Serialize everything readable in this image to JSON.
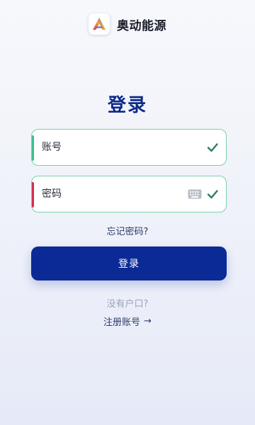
{
  "app": {
    "brand_name": "奥动能源",
    "logo_icon": "triangle-a-logo-icon"
  },
  "page": {
    "title": "登录"
  },
  "form": {
    "account": {
      "placeholder": "账号",
      "value": "",
      "valid": true,
      "accent_color": "#3dbf8f"
    },
    "password": {
      "placeholder": "密码",
      "value": "",
      "valid": true,
      "accent_color": "#d2304f",
      "keyboard_icon": "keyboard-icon"
    },
    "check_icon": "check-icon",
    "check_color": "#2f7d5b",
    "field_border_color": "#7ccfae"
  },
  "links": {
    "forgot_password": "忘记密码?",
    "no_account": "没有户口?",
    "register": "注册账号",
    "register_arrow": "→"
  },
  "buttons": {
    "login": "登录",
    "login_color": "#0b2a95"
  }
}
